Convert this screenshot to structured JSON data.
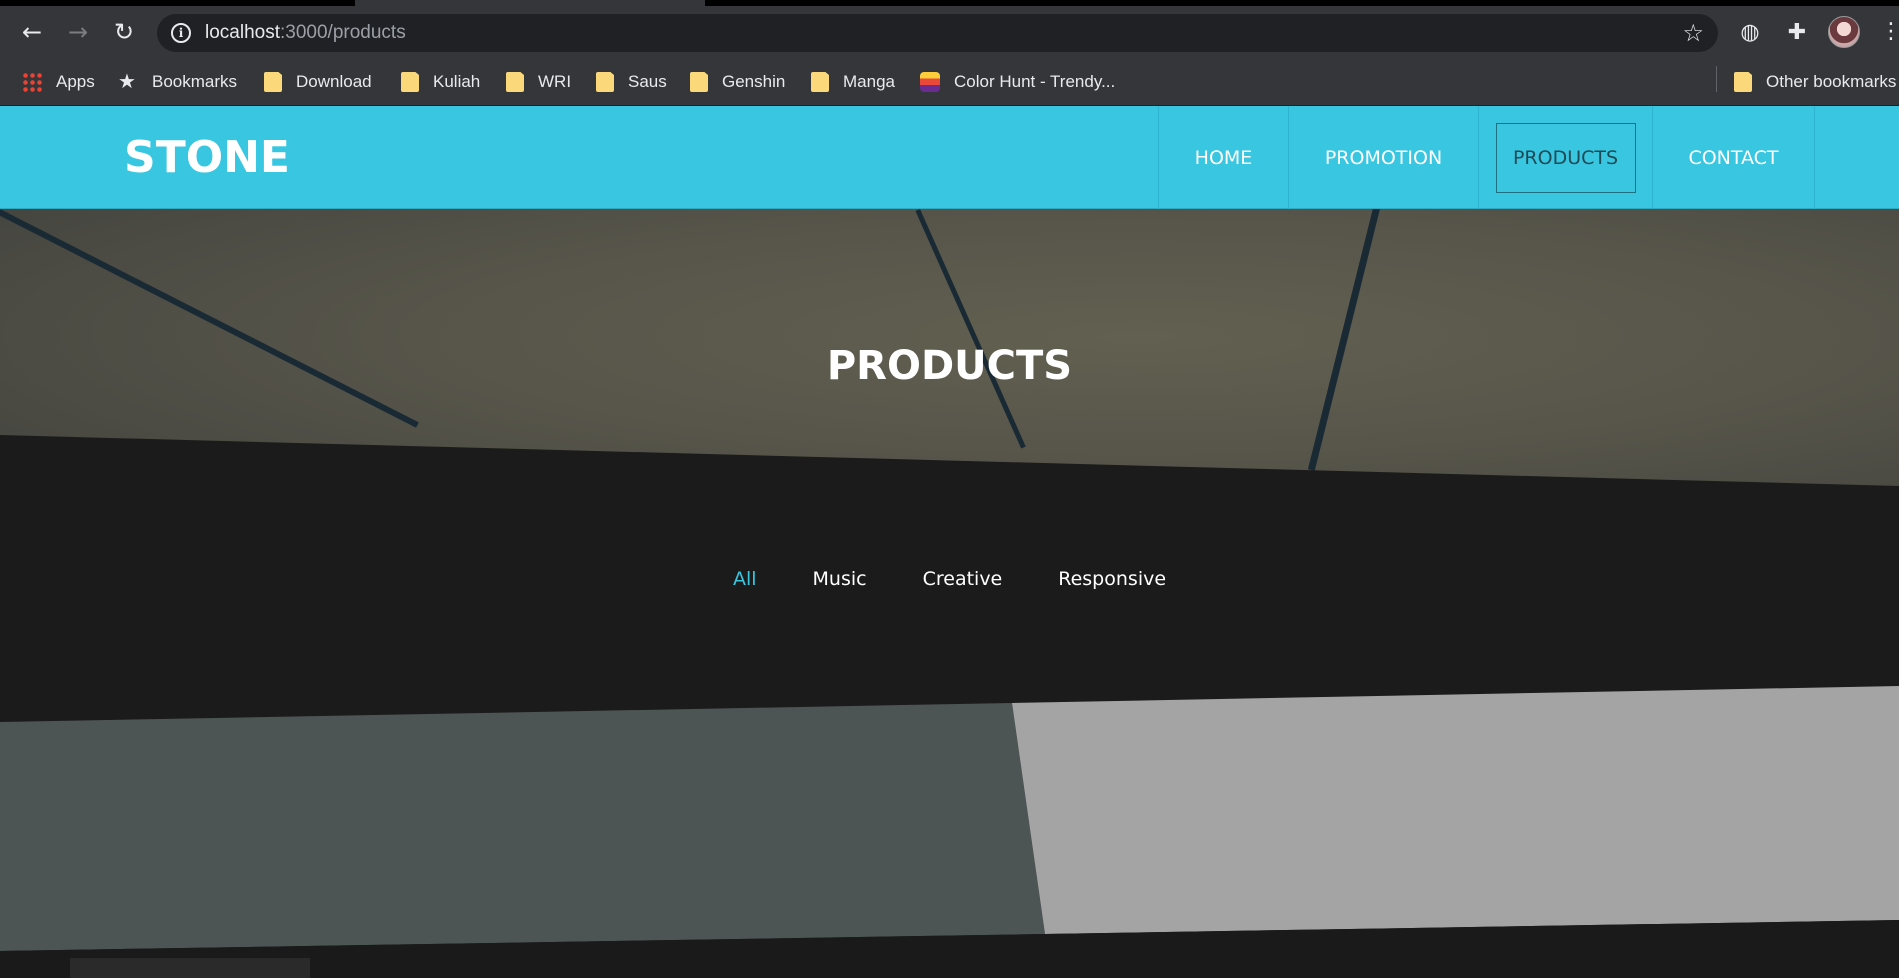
{
  "browser": {
    "url_host": "localhost",
    "url_path": ":3000/products",
    "bookmarks": [
      {
        "label": "Apps",
        "icon": "apps-icon"
      },
      {
        "label": "Bookmarks",
        "icon": "star-icon"
      },
      {
        "label": "Download",
        "icon": "folder-icon"
      },
      {
        "label": "Kuliah",
        "icon": "folder-icon"
      },
      {
        "label": "WRI",
        "icon": "folder-icon"
      },
      {
        "label": "Saus",
        "icon": "folder-icon"
      },
      {
        "label": "Genshin",
        "icon": "folder-icon"
      },
      {
        "label": "Manga",
        "icon": "folder-icon"
      },
      {
        "label": "Color Hunt - Trendy...",
        "icon": "color-hunt-icon"
      }
    ],
    "other_bookmarks": "Other bookmarks"
  },
  "site": {
    "logo": "STONE",
    "nav": [
      {
        "label": "HOME"
      },
      {
        "label": "PROMOTION"
      },
      {
        "label": "PRODUCTS"
      },
      {
        "label": "CONTACT"
      }
    ],
    "hero_title": "PRODUCTS",
    "filters": [
      {
        "label": "All",
        "active": true
      },
      {
        "label": "Music"
      },
      {
        "label": "Creative"
      },
      {
        "label": "Responsive"
      }
    ]
  },
  "colors": {
    "accent": "#38c6e1",
    "dark_bg": "#1b1b1b"
  }
}
